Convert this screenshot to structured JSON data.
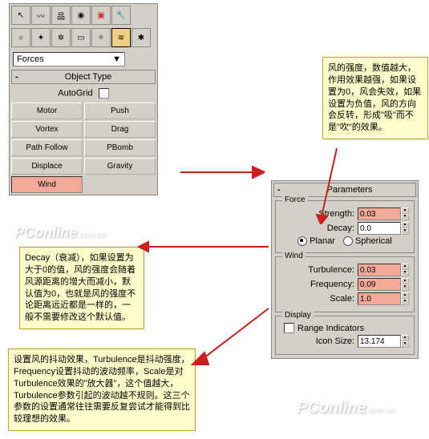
{
  "left_panel": {
    "dropdown_label": "Forces",
    "rollout_title": "Object Type",
    "autogrid_label": "AutoGrid",
    "buttons": [
      "Motor",
      "Push",
      "Vortex",
      "Drag",
      "Path Follow",
      "PBomb",
      "Displace",
      "Gravity",
      "Wind"
    ]
  },
  "right_panel": {
    "rollout_title": "Parameters",
    "force": {
      "legend": "Force",
      "strength_label": "Strength:",
      "strength_value": "0.03",
      "decay_label": "Decay:",
      "decay_value": "0.0",
      "planar_label": "Planar",
      "spherical_label": "Spherical"
    },
    "wind": {
      "legend": "Wind",
      "turbulence_label": "Turbulence:",
      "turbulence_value": "0.03",
      "frequency_label": "Frequency:",
      "frequency_value": "0.09",
      "scale_label": "Scale:",
      "scale_value": "1.0"
    },
    "display": {
      "legend": "Display",
      "range_label": "Range Indicators",
      "icon_size_label": "Icon Size:",
      "icon_size_value": "13.174"
    }
  },
  "notes": {
    "n1": "风的强度，数值越大，作用效果越强，如果设置为0，风会失效，如果设置为负值，风的方向会反转，形成\"吸\"而不是\"吹\"的效果。",
    "n2": "Decay（衰减），如果设置为大于0的值，风的强度会随着风源距离的增大而减小，默认值为0，也就是风的强度不论距离远近都是一样的，一般不需要修改这个默认值。",
    "n3": "设置风的抖动效果，Turbulence是抖动强度，Frequency设置抖动的波动频率，Scale是对Turbulence效果的\"放大器\"，这个值越大，Turbulence参数引起的波动越不规则。这三个参数的设置通常往往需要反复尝试才能得到比较理想的效果。"
  },
  "watermark": {
    "brand": "PConline",
    "suffix": ".com.cn"
  }
}
